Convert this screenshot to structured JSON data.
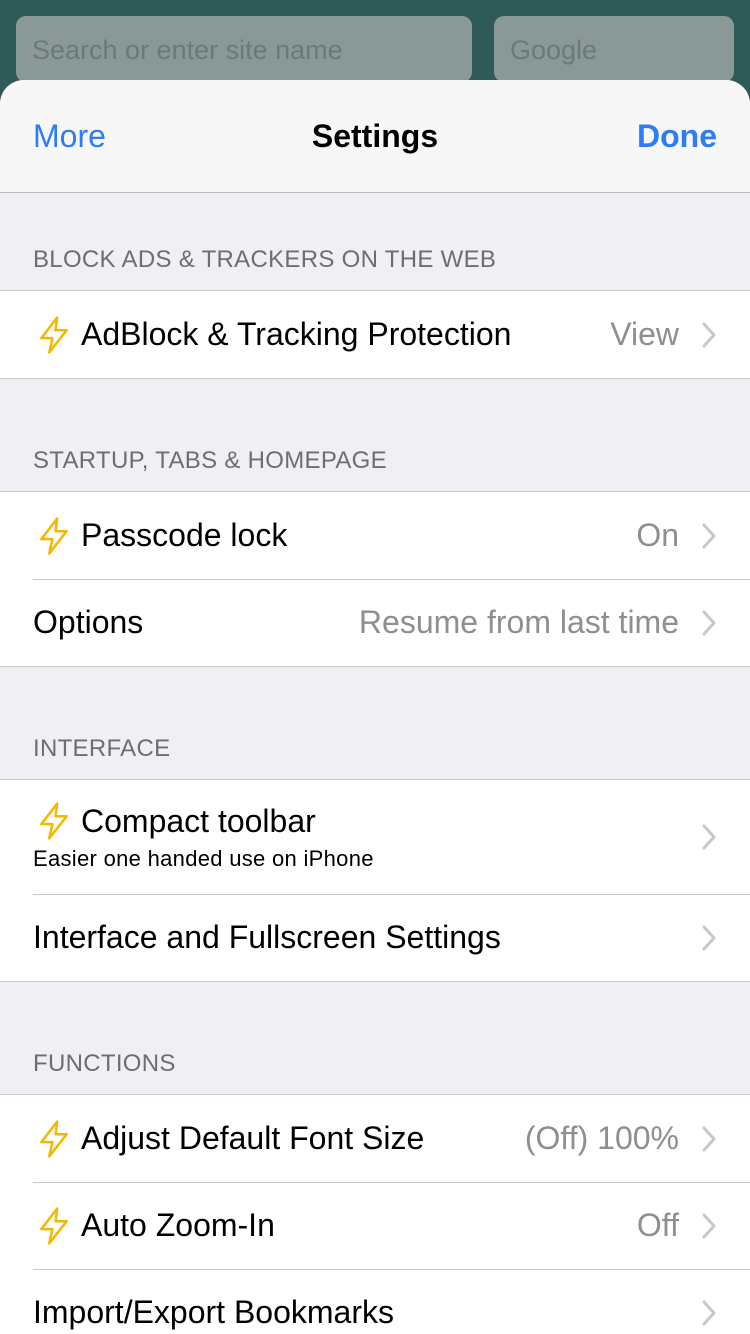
{
  "background": {
    "search_placeholder": "Search or enter site name",
    "engine_label": "Google"
  },
  "nav": {
    "left": "More",
    "title": "Settings",
    "right": "Done"
  },
  "sections": [
    {
      "header": "BLOCK ADS & TRACKERS ON THE WEB",
      "rows": [
        {
          "label": "AdBlock & Tracking Protection",
          "value": "View",
          "icon": "lightning-bolt-icon"
        }
      ]
    },
    {
      "header": "STARTUP, TABS & HOMEPAGE",
      "rows": [
        {
          "label": "Passcode lock",
          "value": "On",
          "icon": "lightning-bolt-icon"
        },
        {
          "label": "Options",
          "value": "Resume from last time"
        }
      ]
    },
    {
      "header": "INTERFACE",
      "rows": [
        {
          "label": "Compact toolbar",
          "sublabel": "Easier one handed use on iPhone",
          "icon": "lightning-bolt-icon"
        },
        {
          "label": "Interface and Fullscreen Settings"
        }
      ]
    },
    {
      "header": "FUNCTIONS",
      "rows": [
        {
          "label": "Adjust Default Font Size",
          "value": "(Off) 100%",
          "icon": "lightning-bolt-icon"
        },
        {
          "label": "Auto Zoom-In",
          "value": "Off",
          "icon": "lightning-bolt-icon"
        },
        {
          "label": "Import/Export Bookmarks"
        }
      ]
    }
  ],
  "colors": {
    "accent": "#2e7cf6",
    "bolt": "#f5b800",
    "secondary_text": "#8e8e93",
    "grouped_background": "#efeff4"
  }
}
